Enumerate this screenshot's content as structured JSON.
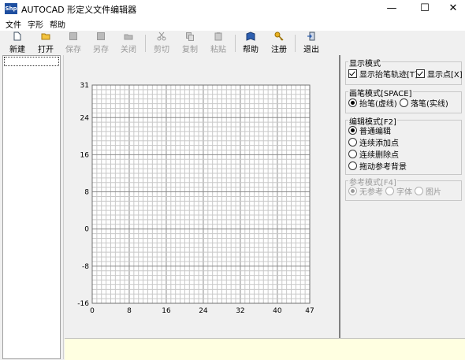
{
  "window": {
    "icon_text": "Shp",
    "title": "AUTOCAD 形定义文件编辑器",
    "minimize": "—",
    "maximize": "☐",
    "close": "✕"
  },
  "menu": {
    "file": "文件",
    "shape": "字形",
    "help": "帮助"
  },
  "toolbar": {
    "new": "新建",
    "open": "打开",
    "save": "保存",
    "save_as": "另存",
    "close": "关闭",
    "cut": "剪切",
    "copy": "复制",
    "paste": "粘贴",
    "help": "帮助",
    "register": "注册",
    "exit": "退出"
  },
  "plot": {
    "x_ticks": [
      "0",
      "8",
      "16",
      "24",
      "32",
      "40",
      "47"
    ],
    "y_ticks": [
      "31",
      "24",
      "16",
      "8",
      "0",
      "-8",
      "-16"
    ],
    "x_range": [
      0,
      47
    ],
    "y_range": [
      -16,
      31
    ]
  },
  "display_mode": {
    "title": "显示模式",
    "show_pen_up": "显示抬笔轨迹[T]",
    "show_pen_up_checked": true,
    "show_points": "显示点[X]",
    "show_points_checked": true
  },
  "pen_mode": {
    "title": "画笔模式[SPACE]",
    "pen_up": "抬笔(虚线)",
    "pen_down": "落笔(实线)",
    "selected": "pen_up"
  },
  "edit_mode": {
    "title": "编辑模式[F2]",
    "options": [
      "普通编辑",
      "连续添加点",
      "连续删除点",
      "拖动参考背景"
    ],
    "selected": 0
  },
  "ref_mode": {
    "title": "参考模式[F4]",
    "options": [
      "无参考",
      "字体",
      "图片"
    ],
    "selected": 0
  }
}
